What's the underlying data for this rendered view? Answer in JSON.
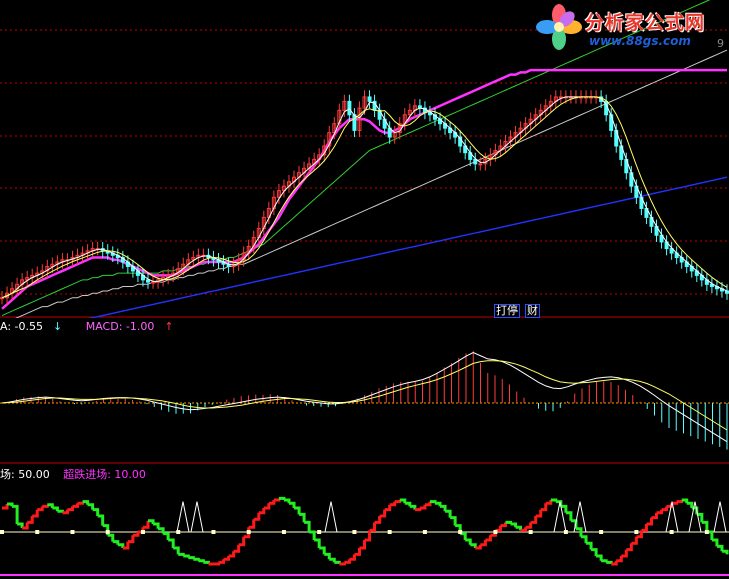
{
  "watermark": {
    "title": "分析家公式网",
    "url": "www.88gs.com"
  },
  "flags": {
    "left": "停",
    "left_prefix": "打",
    "right": "财"
  },
  "top_right_glyph": "9",
  "macd_legend": {
    "dea_label": "A: -0.55",
    "dea_arrow": "↓",
    "macd_label": "MACD: -1.00",
    "macd_arrow": "↑"
  },
  "osc_legend": {
    "left_label": "场: 50.00",
    "right_label": "超跌进场: 10.00"
  },
  "colors": {
    "up": "#ff3a3a",
    "down": "#54ffff",
    "ma_white": "#ffffff",
    "ma_yellow": "#ffff66",
    "ma_magenta": "#ff33ff",
    "ma_green": "#33cc33",
    "ma_gray": "#c8c8c8",
    "ma_blue": "#2233ff",
    "osc_red": "#ff1a1a",
    "osc_green": "#22ee22",
    "osc_line": "#ffffcc",
    "grid": "#c00000"
  },
  "chart_data": [
    {
      "type": "candlestick",
      "name": "price",
      "xlim": [
        0,
        145
      ],
      "ylim": [
        0,
        100
      ],
      "grid": true,
      "closes": [
        10,
        12,
        14,
        16,
        18,
        19,
        20,
        21,
        22,
        24,
        25,
        26,
        27,
        27,
        28,
        29,
        30,
        31,
        32,
        32,
        31,
        30,
        29,
        28,
        26,
        24,
        22,
        20,
        18,
        17,
        17,
        18,
        19,
        20,
        21,
        23,
        25,
        27,
        28,
        29,
        29,
        28,
        27,
        26,
        25,
        24,
        25,
        27,
        30,
        33,
        37,
        41,
        46,
        50,
        55,
        58,
        60,
        62,
        64,
        66,
        68,
        70,
        72,
        74,
        78,
        84,
        88,
        94,
        98,
        92,
        85,
        95,
        100,
        98,
        94,
        90,
        86,
        82,
        84,
        88,
        92,
        94,
        96,
        95,
        93,
        92,
        90,
        88,
        86,
        84,
        82,
        78,
        75,
        72,
        70,
        70,
        72,
        74,
        76,
        78,
        80,
        82,
        84,
        86,
        88,
        90,
        92,
        94,
        96,
        98,
        100,
        100,
        100,
        100,
        100,
        100,
        100,
        100,
        100,
        98,
        92,
        85,
        78,
        72,
        66,
        60,
        55,
        50,
        46,
        42,
        38,
        35,
        32,
        30,
        28,
        26,
        24,
        22,
        20,
        18,
        16,
        15,
        14,
        13,
        12
      ],
      "ma_magenta": [
        5,
        7,
        9,
        11,
        13,
        15,
        16,
        17,
        18,
        19,
        20,
        21,
        22,
        23,
        24,
        25,
        26,
        27,
        28,
        28,
        28,
        28,
        27,
        27,
        26,
        25,
        24,
        23,
        22,
        21,
        20,
        20,
        20,
        20,
        20,
        21,
        22,
        23,
        24,
        25,
        26,
        26,
        26,
        26,
        26,
        26,
        26,
        27,
        28,
        30,
        32,
        34,
        37,
        40,
        43,
        46,
        50,
        54,
        57,
        60,
        63,
        66,
        69,
        72,
        76,
        80,
        83,
        86,
        88,
        90,
        90,
        90,
        90,
        89,
        87,
        85,
        84,
        84,
        85,
        86,
        88,
        90,
        91,
        92,
        93,
        94,
        95,
        96,
        97,
        98,
        99,
        100,
        101,
        102,
        103,
        104,
        105,
        106,
        107,
        108,
        109,
        110,
        110,
        111,
        111,
        112,
        112,
        112,
        112,
        112,
        112,
        112,
        112,
        112,
        112,
        112,
        112,
        112,
        112,
        112,
        112,
        112,
        112,
        112,
        112,
        112,
        112,
        112,
        112,
        112,
        112,
        112,
        112,
        112,
        112,
        112,
        112,
        112,
        112,
        112,
        112,
        112,
        112,
        112,
        112
      ],
      "ma_green": [
        2,
        3,
        4,
        5,
        6,
        7,
        8,
        9,
        10,
        11,
        12,
        13,
        14,
        15,
        16,
        17,
        18,
        18,
        19,
        19,
        20,
        20,
        20,
        21,
        21,
        21,
        21,
        21,
        21,
        21,
        21,
        21,
        22,
        22,
        22,
        23,
        23,
        24,
        24,
        25,
        25,
        26,
        26,
        27,
        27,
        28,
        28,
        29,
        30,
        31,
        32,
        33,
        34,
        36,
        38,
        40,
        42,
        44,
        46,
        48,
        50,
        52,
        54,
        56,
        58,
        60,
        62,
        64,
        66,
        68,
        70,
        72,
        74,
        76,
        77,
        78,
        79,
        80,
        81,
        82,
        83,
        84,
        85,
        86,
        87,
        88,
        89,
        90,
        91,
        92,
        93,
        94,
        95,
        96,
        97,
        98,
        99,
        100,
        101,
        102,
        103,
        104,
        105,
        106,
        107,
        108,
        109,
        110,
        111,
        112,
        113,
        114,
        115,
        116,
        117,
        118,
        119,
        120,
        121,
        122,
        123,
        124,
        125,
        126,
        127,
        128,
        129,
        130,
        131,
        132,
        133,
        134,
        135,
        136,
        137,
        138,
        139,
        140,
        141,
        142,
        143,
        144,
        145,
        146,
        147
      ],
      "ma_gray": [
        -2,
        -1,
        0,
        1,
        2,
        3,
        4,
        5,
        6,
        6,
        7,
        8,
        8,
        9,
        10,
        10,
        11,
        11,
        12,
        12,
        13,
        13,
        14,
        14,
        15,
        15,
        15,
        16,
        16,
        16,
        17,
        17,
        17,
        18,
        18,
        19,
        19,
        20,
        20,
        21,
        21,
        22,
        22,
        23,
        23,
        24,
        24,
        25,
        25,
        26,
        27,
        28,
        29,
        30,
        31,
        32,
        33,
        34,
        35,
        36,
        37,
        38,
        39,
        40,
        41,
        42,
        43,
        44,
        45,
        46,
        47,
        48,
        49,
        50,
        51,
        52,
        53,
        54,
        55,
        56,
        57,
        58,
        59,
        60,
        61,
        62,
        63,
        64,
        65,
        66,
        67,
        68,
        69,
        70,
        71,
        72,
        73,
        74,
        75,
        76,
        77,
        78,
        79,
        80,
        81,
        82,
        83,
        84,
        85,
        86,
        87,
        88,
        89,
        90,
        91,
        92,
        93,
        94,
        95,
        96,
        97,
        98,
        99,
        100,
        101,
        102,
        103,
        104,
        105,
        106,
        107,
        108,
        109,
        110,
        111,
        112,
        113,
        114,
        115,
        116,
        117,
        118,
        119,
        120,
        121
      ],
      "ma_blue": [
        -8,
        -7.5,
        -7,
        -6.5,
        -6,
        -5.5,
        -5,
        -4.5,
        -4,
        -3.5,
        -3,
        -2.5,
        -2,
        -1.5,
        -1,
        -0.5,
        0,
        0.5,
        1,
        1.5,
        2,
        2.5,
        3,
        3.5,
        4,
        4.5,
        5,
        5.5,
        6,
        6.5,
        7,
        7.5,
        8,
        8.5,
        9,
        9.5,
        10,
        10.5,
        11,
        11.5,
        12,
        12.5,
        13,
        13.5,
        14,
        14.5,
        15,
        15.5,
        16,
        16.5,
        17,
        17.5,
        18,
        18.5,
        19,
        19.5,
        20,
        20.5,
        21,
        21.5,
        22,
        22.5,
        23,
        23.5,
        24,
        24.5,
        25,
        25.5,
        26,
        26.5,
        27,
        27.5,
        28,
        28.5,
        29,
        29.5,
        30,
        30.5,
        31,
        31.5,
        32,
        32.5,
        33,
        33.5,
        34,
        34.5,
        35,
        35.5,
        36,
        36.5,
        37,
        37.5,
        38,
        38.5,
        39,
        39.5,
        40,
        40.5,
        41,
        41.5,
        42,
        42.5,
        43,
        43.5,
        44,
        44.5,
        45,
        45.5,
        46,
        46.5,
        47,
        47.5,
        48,
        48.5,
        49,
        49.5,
        50,
        50.5,
        51,
        51.5,
        52,
        52.5,
        53,
        53.5,
        54,
        54.5,
        55,
        55.5,
        56,
        56.5,
        57,
        57.5,
        58,
        58.5,
        59,
        59.5,
        60,
        60.5,
        61,
        61.5,
        62,
        62.5,
        63,
        63.5,
        64
      ]
    },
    {
      "type": "macd",
      "ylim": [
        -1.6,
        1.6
      ],
      "dif": [
        0,
        0.02,
        0.05,
        0.08,
        0.1,
        0.12,
        0.13,
        0.12,
        0.1,
        0.08,
        0.06,
        0.05,
        0.06,
        0.08,
        0.1,
        0.11,
        0.12,
        0.12,
        0.11,
        0.09,
        0.06,
        0.02,
        -0.02,
        -0.06,
        -0.1,
        -0.13,
        -0.15,
        -0.14,
        -0.12,
        -0.1,
        -0.07,
        -0.04,
        -0.01,
        0.02,
        0.05,
        0.08,
        0.1,
        0.12,
        0.13,
        0.12,
        0.1,
        0.07,
        0.04,
        0.02,
        0,
        -0.02,
        -0.02,
        0,
        0.03,
        0.07,
        0.12,
        0.18,
        0.24,
        0.3,
        0.36,
        0.41,
        0.45,
        0.48,
        0.52,
        0.58,
        0.66,
        0.75,
        0.84,
        0.94,
        1.04,
        1.12,
        1.05,
        0.98,
        0.96,
        0.92,
        0.85,
        0.76,
        0.66,
        0.56,
        0.46,
        0.38,
        0.33,
        0.32,
        0.36,
        0.42,
        0.47,
        0.51,
        0.55,
        0.57,
        0.58,
        0.56,
        0.52,
        0.46,
        0.38,
        0.28,
        0.17,
        0.05,
        -0.06,
        -0.16,
        -0.26,
        -0.36,
        -0.46,
        -0.56,
        -0.66,
        -0.76,
        -0.86
      ],
      "dea": [
        0,
        0.01,
        0.02,
        0.04,
        0.06,
        0.08,
        0.1,
        0.11,
        0.11,
        0.1,
        0.09,
        0.08,
        0.08,
        0.08,
        0.09,
        0.1,
        0.11,
        0.11,
        0.11,
        0.1,
        0.09,
        0.07,
        0.05,
        0.02,
        -0.01,
        -0.05,
        -0.08,
        -0.1,
        -0.11,
        -0.11,
        -0.1,
        -0.09,
        -0.07,
        -0.05,
        -0.02,
        0.01,
        0.04,
        0.06,
        0.08,
        0.1,
        0.1,
        0.09,
        0.08,
        0.06,
        0.04,
        0.02,
        0.01,
        0.01,
        0.02,
        0.04,
        0.07,
        0.11,
        0.15,
        0.2,
        0.25,
        0.3,
        0.35,
        0.39,
        0.43,
        0.47,
        0.52,
        0.58,
        0.65,
        0.72,
        0.8,
        0.88,
        0.92,
        0.94,
        0.94,
        0.93,
        0.9,
        0.86,
        0.8,
        0.73,
        0.66,
        0.58,
        0.52,
        0.47,
        0.45,
        0.44,
        0.45,
        0.46,
        0.48,
        0.5,
        0.52,
        0.53,
        0.53,
        0.51,
        0.48,
        0.43,
        0.36,
        0.28,
        0.2,
        0.1,
        0,
        -0.1,
        -0.2,
        -0.3,
        -0.4,
        -0.5,
        -0.6
      ]
    },
    {
      "type": "oscillator",
      "ylim": [
        0,
        100
      ],
      "levels": [
        50,
        10
      ],
      "values": [
        80,
        85,
        82,
        60,
        55,
        62,
        70,
        78,
        82,
        84,
        80,
        76,
        74,
        78,
        82,
        86,
        88,
        84,
        78,
        70,
        58,
        46,
        38,
        34,
        30,
        38,
        46,
        50,
        56,
        64,
        60,
        54,
        48,
        40,
        30,
        22,
        20,
        18,
        16,
        14,
        12,
        10,
        10,
        12,
        16,
        20,
        26,
        34,
        44,
        56,
        66,
        74,
        80,
        86,
        90,
        92,
        90,
        86,
        80,
        72,
        62,
        50,
        40,
        30,
        22,
        16,
        12,
        10,
        12,
        16,
        22,
        30,
        40,
        52,
        62,
        70,
        78,
        84,
        88,
        90,
        86,
        82,
        78,
        80,
        84,
        88,
        86,
        82,
        76,
        68,
        58,
        48,
        40,
        34,
        30,
        34,
        40,
        46,
        52,
        58,
        62,
        60,
        56,
        52,
        56,
        62,
        70,
        78,
        86,
        90,
        88,
        82,
        74,
        64,
        54,
        44,
        36,
        28,
        20,
        14,
        12,
        10,
        14,
        20,
        28,
        36,
        44,
        52,
        60,
        68,
        74,
        78,
        82,
        86,
        88,
        90,
        86,
        80,
        72,
        62,
        50,
        40,
        32,
        26,
        22
      ]
    }
  ]
}
